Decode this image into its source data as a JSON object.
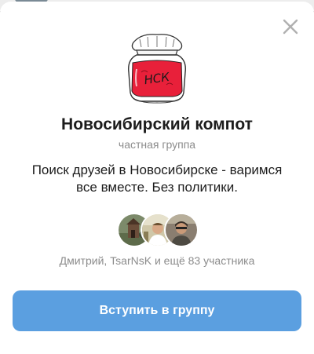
{
  "group": {
    "title": "Новосибирский компот",
    "type": "частная группа",
    "description": "Поиск друзей в Новосибирске - варимся все вместе. Без политики.",
    "logo_label": "НСК",
    "logo_icon": "jam-jar-icon"
  },
  "members": {
    "summary": "Дмитрий, TsarNsK и ещё 83 участника",
    "avatars": [
      "avatar-1",
      "avatar-2",
      "avatar-3"
    ]
  },
  "actions": {
    "join_label": "Вступить в группу"
  },
  "colors": {
    "accent": "#5b9fe0",
    "jar_red": "#e8203a",
    "muted_text": "#8c8c8c",
    "close_icon": "#b0b0b0"
  }
}
